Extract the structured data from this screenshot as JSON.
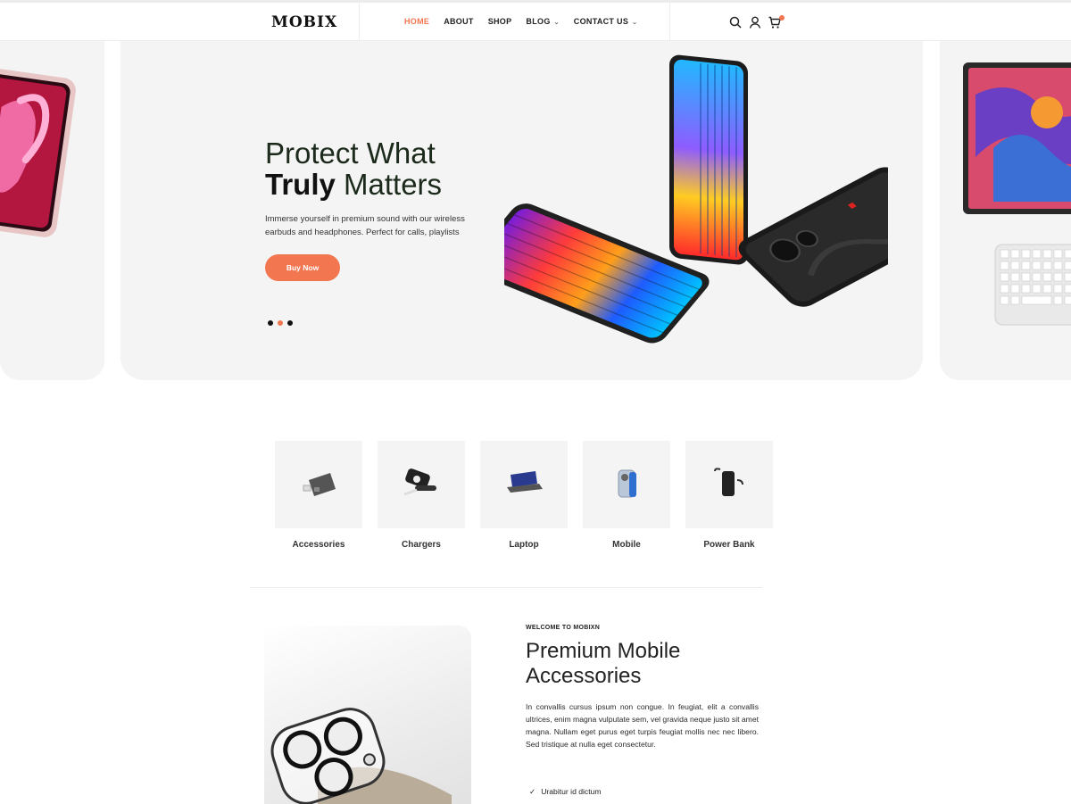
{
  "header": {
    "logo": "MOBIX",
    "nav": [
      {
        "label": "HOME",
        "active": true
      },
      {
        "label": "ABOUT"
      },
      {
        "label": "SHOP"
      },
      {
        "label": "BLOG",
        "has_dropdown": true
      },
      {
        "label": "CONTACT US",
        "has_dropdown": true
      }
    ],
    "icons": [
      "search-icon",
      "user-icon",
      "cart-icon"
    ]
  },
  "hero": {
    "title_line1": "Protect What",
    "title_bold": "Truly",
    "title_rest": " Matters",
    "description": "Immerse yourself in premium sound with our wireless earbuds and headphones. Perfect for calls, playlists",
    "button": "Buy Now",
    "slide_count": 3,
    "active_slide": 2
  },
  "categories": [
    {
      "label": "Accessories"
    },
    {
      "label": "Chargers"
    },
    {
      "label": "Laptop"
    },
    {
      "label": "Mobile"
    },
    {
      "label": "Power Bank"
    }
  ],
  "about": {
    "eyebrow": "WELCOME TO MOBIXN",
    "title": "Premium Mobile Accessories",
    "text": "In convallis cursus ipsum non congue. In feugiat, elit a convallis ultrices, enim magna vulputate sem, vel gravida neque justo sit amet magna. Nullam eget purus eget turpis feugiat mollis nec nec libero. Sed tristique at nulla eget consectetur.",
    "bullets": [
      "Urabitur id dictum"
    ]
  },
  "colors": {
    "accent": "#f27650",
    "panel": "#f4f4f4",
    "text": "#222222"
  }
}
